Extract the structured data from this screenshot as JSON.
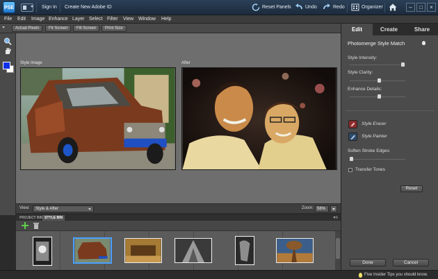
{
  "titlebar": {
    "logo": "PSE",
    "sign_in": "Sign In",
    "create_id": "Create New Adobe ID",
    "reset_panels": "Reset Panels",
    "undo": "Undo",
    "redo": "Redo",
    "organizer": "Organizer"
  },
  "menu": [
    "File",
    "Edit",
    "Image",
    "Enhance",
    "Layer",
    "Select",
    "Filter",
    "View",
    "Window",
    "Help"
  ],
  "options": {
    "actual_pixels": "Actual Pixels",
    "fit_screen": "Fit Screen",
    "fill_screen": "Fill Screen",
    "print_size": "Print Size"
  },
  "canvas": {
    "style_image_label": "Style Image",
    "after_label": "After"
  },
  "viewbar": {
    "view_label": "View:",
    "view_value": "Style & After",
    "zoom_label": "Zoom:",
    "zoom_value": "56%"
  },
  "bin": {
    "tabs": [
      "PROJECT BIN",
      "STYLE BIN"
    ],
    "active_tab": "STYLE BIN"
  },
  "panel": {
    "tabs": [
      "Edit",
      "Create",
      "Share"
    ],
    "active_tab": "Edit",
    "title": "Photomerge Style Match",
    "intensity_label": "Style Intensity:",
    "clarity_label": "Style Clarity:",
    "details_label": "Enhance Details:",
    "intensity_value": 0.98,
    "clarity_value": 0.53,
    "details_value": 0.53,
    "eraser_label": "Style Eraser",
    "painter_label": "Style Painter",
    "soften_label": "Soften Stroke Edges:",
    "soften_value": 0.0,
    "transfer_label": "Transfer Tones",
    "reset": "Reset",
    "done": "Done",
    "cancel": "Cancel"
  },
  "status": {
    "tip": "Five Insider Tips you should know."
  }
}
